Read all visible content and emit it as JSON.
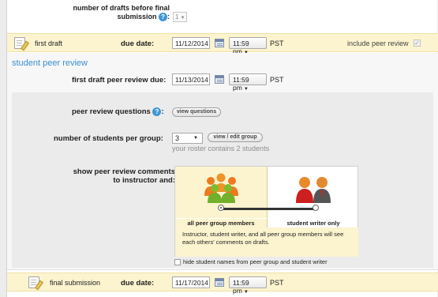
{
  "drafts": {
    "label": "number of drafts before final",
    "label2": "submission",
    "colon": ":",
    "value": "1"
  },
  "first_draft": {
    "title": "first draft",
    "due_label": "due date:",
    "date": "11/12/2014",
    "time": "11:59 pm",
    "tz": "PST",
    "include_label": "include peer review",
    "include_checked": true
  },
  "peer_review": {
    "section_title": "student peer review",
    "review_due_label": "first draft peer review due:",
    "review_date": "11/13/2014",
    "review_time": "11:59 pm",
    "review_tz": "PST",
    "questions_label": "peer review questions",
    "questions_colon": ":",
    "view_questions": "view questions",
    "group_label": "number of students per group:",
    "group_value": "3",
    "view_edit_group": "view / edit group",
    "roster_note": "your roster contains 2 students",
    "show_label_1": "show peer review comments",
    "show_label_2": "to instructor and:",
    "option_all": "all peer group members",
    "option_writer": "student writer only",
    "selected_option": "all peer group members",
    "description": "Instructor, student writer, and all peer group members will see each others' comments on drafts.",
    "hide_names_label": "hide student names from peer group and student writer",
    "hide_names_checked": false
  },
  "final": {
    "title": "final submission",
    "due_label": "due date:",
    "date": "11/17/2014",
    "time": "11:59 pm",
    "tz": "PST"
  },
  "colors": {
    "band": "#fcf4cf",
    "accent_blue": "#3a8fd0",
    "help_icon": "#3f97d6",
    "grey_panel": "#ebebeb"
  }
}
